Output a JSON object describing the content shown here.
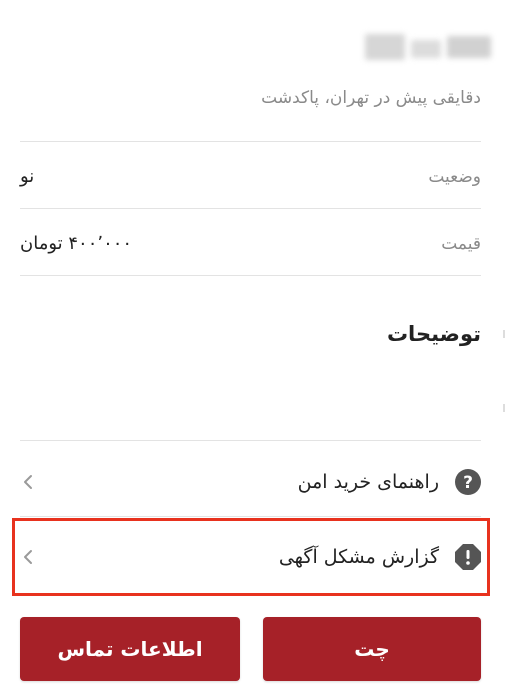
{
  "listing": {
    "subtitle": "دقایقی پیش در تهران، پاکدشت"
  },
  "details": [
    {
      "label": "وضعیت",
      "value": "نو"
    },
    {
      "label": "قیمت",
      "value": "۴۰۰٬۰۰۰ تومان"
    }
  ],
  "description": {
    "title": "توضیحات"
  },
  "menu": [
    {
      "label": "راهنمای خرید امن",
      "icon": "question-circle-icon"
    },
    {
      "label": "گزارش مشکل آگهی",
      "icon": "alert-octagon-icon"
    }
  ],
  "actions": {
    "chat_label": "چت",
    "contact_label": "اطلاعات تماس"
  },
  "colors": {
    "primary": "#a62128",
    "highlight": "#e8321e",
    "icon": "#555555"
  }
}
